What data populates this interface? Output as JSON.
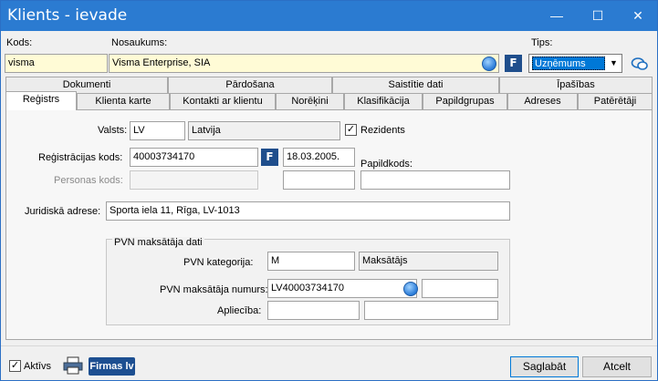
{
  "window": {
    "title": "Klients - ievade"
  },
  "header": {
    "kods_label": "Kods:",
    "kods_value": "visma",
    "nosaukums_label": "Nosaukums:",
    "nosaukums_value": "Visma Enterprise, SIA",
    "tips_label": "Tips:",
    "tips_value": "Uzņēmums"
  },
  "tabs_row1": [
    "Dokumenti",
    "Pārdošana",
    "Saistītie dati",
    "Īpašības"
  ],
  "tabs_row2": [
    "Reģistrs",
    "Klienta karte",
    "Kontakti ar klientu",
    "Norēķini",
    "Klasifikācija",
    "Papildgrupas",
    "Adreses",
    "Patērētāji"
  ],
  "active_tab": "Reģistrs",
  "registrs": {
    "valsts_label": "Valsts:",
    "valsts_code": "LV",
    "valsts_name": "Latvija",
    "rezidents_label": "Rezidents",
    "rezidents_checked": true,
    "reg_kods_label": "Reģistrācijas kods:",
    "reg_kods_value": "40003734170",
    "reg_date": "18.03.2005.",
    "papildkods_label": "Papildkods:",
    "personas_kods_label": "Personas kods:",
    "personas_kods_value": "",
    "jur_adrese_label": "Juridiskā adrese:",
    "jur_adrese_value": "Sporta iela 11, Rīga, LV-1013"
  },
  "pvn": {
    "group_title": "PVN maksātāja dati",
    "kategorija_label": "PVN kategorija:",
    "kategorija_code": "M",
    "kategorija_name": "Maksātājs",
    "numurs_label": "PVN maksātāja numurs:",
    "numurs_value": "LV40003734170",
    "apliecibа_label": "Apliecība:"
  },
  "footer": {
    "aktivs_label": "Aktīvs",
    "aktivs_checked": true,
    "firmas_label": "Firmas lv",
    "save_label": "Saglabāt",
    "cancel_label": "Atcelt"
  },
  "colors": {
    "titlebar": "#2b7bd1",
    "accent": "#0078d7",
    "required_field": "#fffbd6"
  }
}
